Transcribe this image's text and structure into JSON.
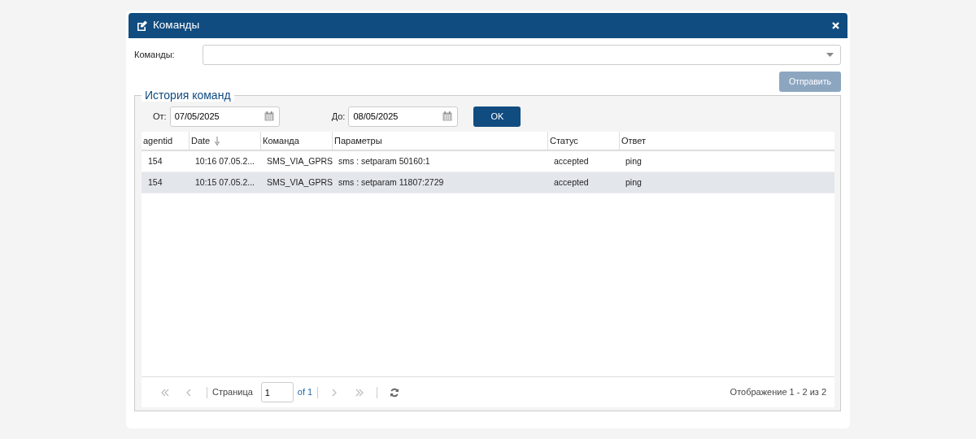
{
  "dialog": {
    "title": "Команды"
  },
  "command": {
    "label": "Команды:"
  },
  "send_button": {
    "label": "Отправить",
    "disabled": true
  },
  "history": {
    "legend": "История команд",
    "from": {
      "label": "От:",
      "value": "07/05/2025"
    },
    "to": {
      "label": "До:",
      "value": "08/05/2025"
    },
    "ok_button": {
      "label": "OK"
    }
  },
  "table": {
    "columns": [
      {
        "label": "agentid",
        "sorted": false
      },
      {
        "label": "Date",
        "sorted": true
      },
      {
        "label": "Команда",
        "sorted": false
      },
      {
        "label": "Параметры",
        "sorted": false
      },
      {
        "label": "Статус",
        "sorted": false
      },
      {
        "label": "Ответ",
        "sorted": false
      }
    ],
    "rows": [
      {
        "cells": [
          "154",
          "10:16 07.05.2...",
          "SMS_VIA_GPRS",
          "sms : setparam 50160:1",
          "accepted",
          "ping"
        ],
        "selected": false
      },
      {
        "cells": [
          "154",
          "10:15 07.05.2...",
          "SMS_VIA_GPRS",
          "sms : setparam 11807:2729",
          "accepted",
          "ping"
        ],
        "selected": true
      }
    ]
  },
  "pager": {
    "nav": [
      {
        "kind": "first",
        "disabled": true
      },
      {
        "kind": "prev",
        "disabled": true
      },
      {
        "kind": "next",
        "disabled": true
      },
      {
        "kind": "last",
        "disabled": true
      }
    ],
    "page_label": "Страница",
    "page": "1",
    "of": "of 1",
    "display": "Отображение 1 - 2 из 2"
  }
}
